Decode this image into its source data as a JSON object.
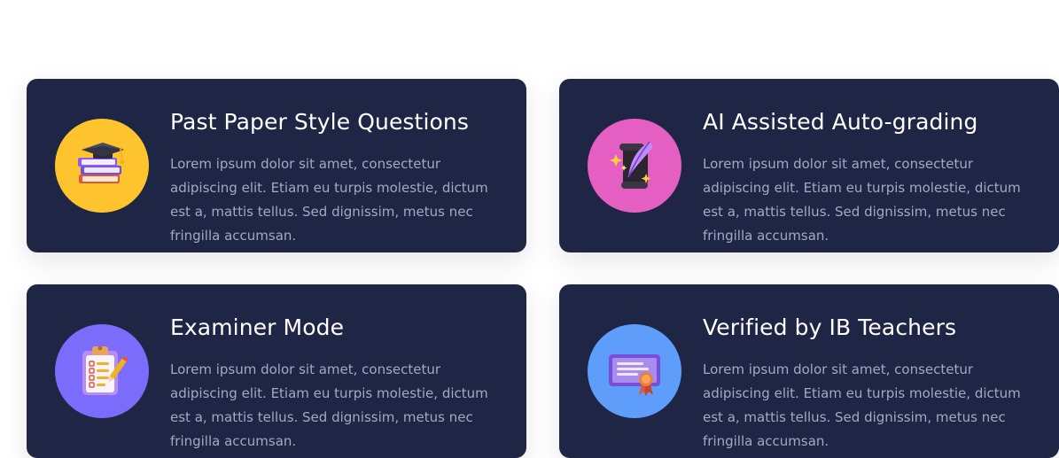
{
  "features": [
    {
      "title": "Past Paper Style Questions",
      "description": "Lorem ipsum dolor sit amet, consectetur adipiscing elit. Etiam eu turpis molestie, dictum est a, mattis tellus. Sed dignissim, metus nec fringilla accumsan.",
      "icon": "books-graduation-cap-icon",
      "circle_color": "#fec42d"
    },
    {
      "title": "AI Assisted Auto-grading",
      "description": "Lorem ipsum dolor sit amet, consectetur adipiscing elit. Etiam eu turpis molestie, dictum est a, mattis tellus. Sed dignissim, metus nec fringilla accumsan.",
      "icon": "quill-scroll-sparkle-icon",
      "circle_color": "#e45fc1"
    },
    {
      "title": "Examiner Mode",
      "description": "Lorem ipsum dolor sit amet, consectetur adipiscing elit. Etiam eu turpis molestie, dictum est a, mattis tellus. Sed dignissim, metus nec fringilla accumsan.",
      "icon": "clipboard-checklist-icon",
      "circle_color": "#7b6cfb"
    },
    {
      "title": "Verified by IB Teachers",
      "description": "Lorem ipsum dolor sit amet, consectetur adipiscing elit. Etiam eu turpis molestie, dictum est a, mattis tellus. Sed dignissim, metus nec fringilla accumsan.",
      "icon": "certificate-icon",
      "circle_color": "#5f9dfb"
    }
  ],
  "colors": {
    "page_background": "#ffffff",
    "card_background": "#1f2545",
    "title_text": "#ffffff",
    "description_text": "#a3a8c3"
  }
}
